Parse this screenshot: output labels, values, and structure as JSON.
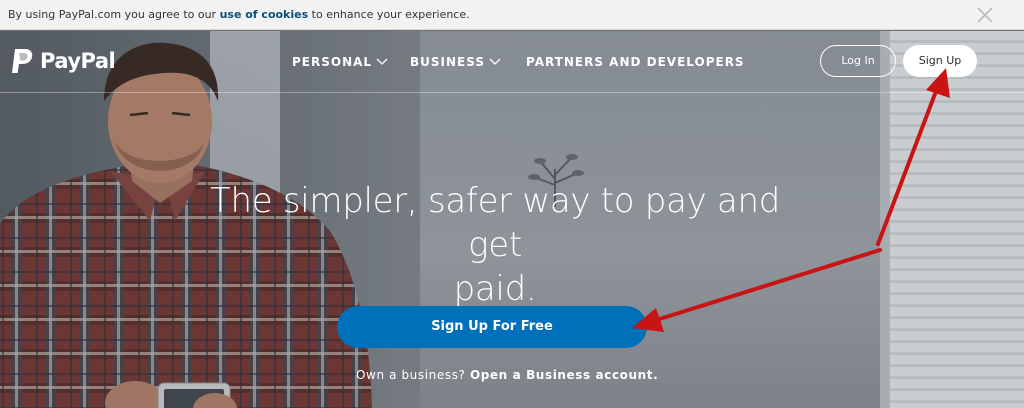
{
  "cookie_bar": {
    "text_before": "By using PayPal.com you agree to our ",
    "link": "use of cookies",
    "text_after": " to enhance your experience.",
    "close_icon": "close-icon"
  },
  "header": {
    "logo_text": "PayPal",
    "logo_icon": "paypal-logo-icon",
    "nav": [
      {
        "label": "PERSONAL",
        "has_dropdown": true
      },
      {
        "label": "BUSINESS",
        "has_dropdown": true
      },
      {
        "label": "PARTNERS AND DEVELOPERS",
        "has_dropdown": false
      }
    ],
    "login_label": "Log In",
    "signup_label": "Sign Up"
  },
  "hero": {
    "headline_line1": "The simpler, safer way to pay and get",
    "headline_line2": "paid.",
    "cta_label": "Sign Up For Free",
    "business_prompt": "Own a business? ",
    "business_link": "Open a Business account."
  },
  "colors": {
    "cta_blue": "#0070ba",
    "annotation_arrow": "#c81414",
    "cookie_link": "#0b4e7a"
  }
}
